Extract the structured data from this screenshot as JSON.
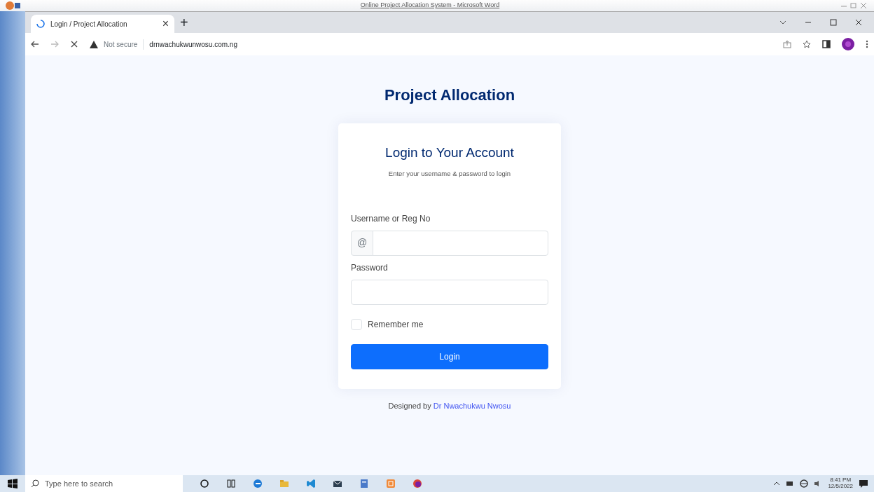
{
  "word_window": {
    "title": "Online Project Allocation System - Microsoft Word"
  },
  "browser": {
    "tab": {
      "title": "Login / Project Allocation",
      "close": "×"
    },
    "new_tab": "+",
    "address": {
      "security": "Not secure",
      "url": "drnwachukwunwosu.com.ng"
    }
  },
  "page": {
    "heading": "Project Allocation",
    "card": {
      "title": "Login to Your Account",
      "subtitle": "Enter your username & password to login",
      "fields": [
        {
          "label": "Username or Reg No",
          "prefix": "@"
        },
        {
          "label": "Password"
        }
      ],
      "remember": {
        "label": "Remember me",
        "checked": false
      },
      "button": "Login"
    },
    "footer": {
      "text": "Designed by",
      "link": "Dr Nwachukwu Nwosu"
    }
  },
  "taskbar": {
    "search": {
      "placeholder": "Type here to search"
    },
    "time": "8:41 PM",
    "date": "12/5/2022"
  }
}
